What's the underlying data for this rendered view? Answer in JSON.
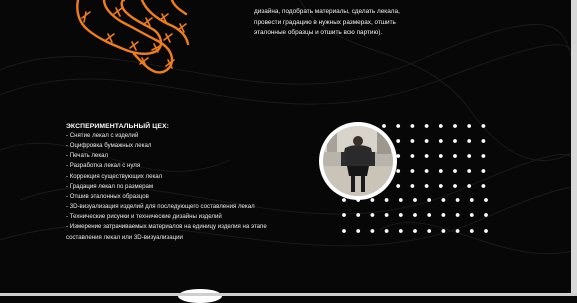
{
  "intro": {
    "lines": [
      "дизайна, подобрать материалы, сделать лекала,",
      "провести градацию в нужных размерах, отшить",
      "эталонные образцы и отшить всю партию)."
    ]
  },
  "section": {
    "title": "ЭКСПЕРИМЕНТАЛЬНЫЙ ЦЕХ:",
    "items": [
      "- Снятие лекал с изделий",
      "- Оцифровка бумажных лекал",
      "- Печать лекал",
      "- Разработка лекал с нуля",
      "- Коррекция существующих лекал",
      "- Градация лекал по размерам",
      "- Отшив эталонных образцов",
      "- 3D-визуализация изделий для последующего составления лекал",
      "- Технические рисунки и технические дизайны изделий",
      "- Измерение затрачиваемых материалов на единицу изделия на этапе составления лекал или 3D-визуализации"
    ]
  },
  "colors": {
    "background": "#070707",
    "accent_orange": "#f07d1a",
    "text": "#eaeaea"
  },
  "icons": {
    "decoration": "barbed-wire-hand-icon",
    "photo": "fashion-model-photo"
  }
}
